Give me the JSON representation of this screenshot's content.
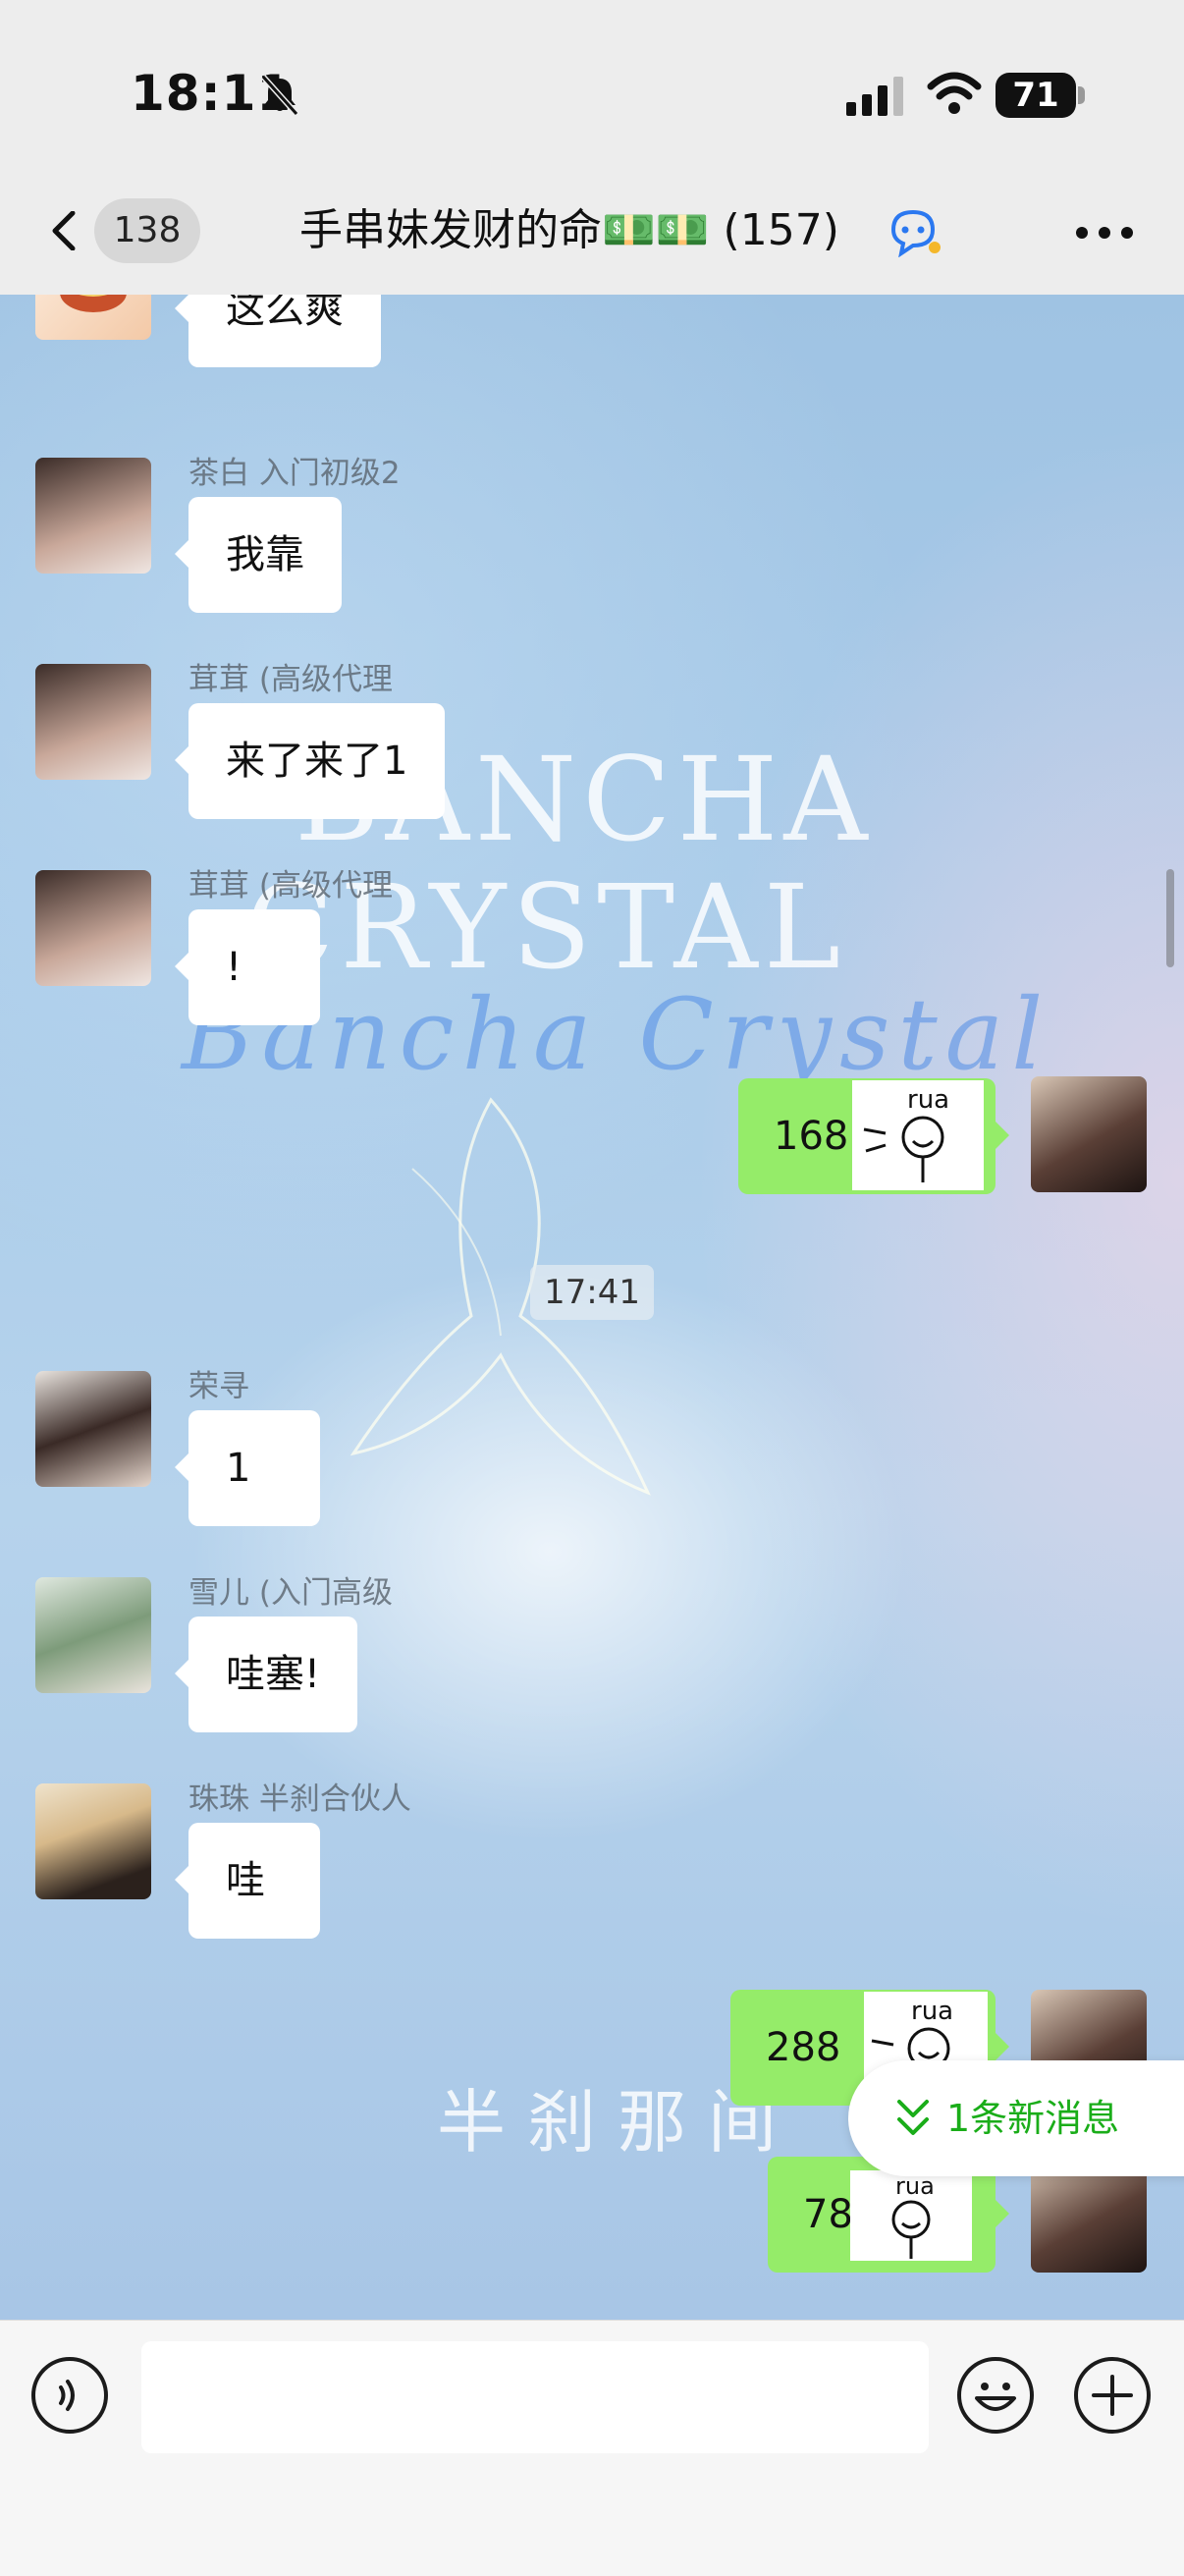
{
  "status_bar": {
    "time": "18:11",
    "battery": "71"
  },
  "nav": {
    "unread_count": "138",
    "title": "手串妹发财的命💵💵 (157)"
  },
  "watermark": {
    "line1": "BANCHA",
    "line2": "CRYSTAL",
    "script": "Bancha Crystal",
    "bottom": "半刹那间"
  },
  "messages": [
    {
      "type": "in",
      "sender": "",
      "text": "这么爽"
    },
    {
      "type": "in",
      "sender": "茶白 入门初级2",
      "text": "我靠"
    },
    {
      "type": "in",
      "sender": "茸茸 (高级代理",
      "text": "来了来了1"
    },
    {
      "type": "in",
      "sender": "茸茸 (高级代理",
      "text": "!"
    },
    {
      "type": "out",
      "text": "168",
      "sticker_text": "rua"
    },
    {
      "type": "time",
      "text": "17:41"
    },
    {
      "type": "in",
      "sender": "荣寻",
      "text": "1"
    },
    {
      "type": "in",
      "sender": "雪儿 (入门高级",
      "text": "哇塞!"
    },
    {
      "type": "in",
      "sender": "珠珠 半刹合伙人",
      "text": "哇"
    },
    {
      "type": "out",
      "text": "288",
      "sticker_text": "rua"
    },
    {
      "type": "out",
      "text": "78",
      "sticker_text": "rua"
    }
  ],
  "new_message_banner": "1条新消息",
  "colors": {
    "outgoing_bubble": "#95ec69",
    "accent_green": "#1aad19",
    "nav_bg": "#ededed"
  },
  "icons": [
    "back-icon",
    "robot-icon",
    "more-icon",
    "voice-icon",
    "emoji-icon",
    "plus-icon",
    "bell-mute-icon",
    "signal-icon",
    "wifi-icon"
  ]
}
